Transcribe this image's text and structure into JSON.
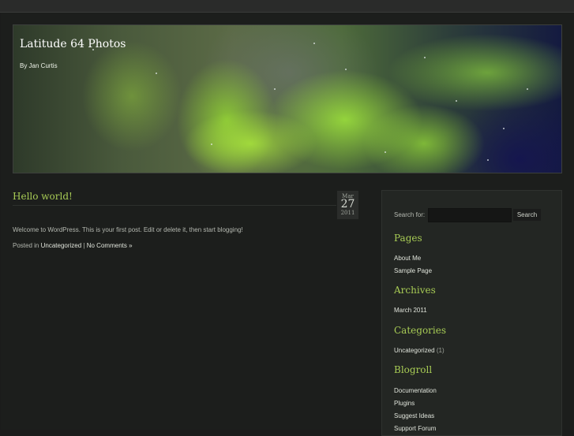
{
  "site": {
    "title": "Latitude 64 Photos",
    "description": "By Jan Curtis"
  },
  "post": {
    "title": "Hello world!",
    "date": {
      "month": "Mar",
      "day": "27",
      "year": "2011"
    },
    "body": "Welcome to WordPress. This is your first post. Edit or delete it, then start blogging!",
    "posted_in": "Posted in",
    "category": "Uncategorized",
    "separator": "|",
    "comments": "No Comments »"
  },
  "sidebar": {
    "search": {
      "label": "Search for:",
      "value": "",
      "button": "Search"
    },
    "pages": {
      "title": "Pages",
      "items": [
        "About Me",
        "Sample Page"
      ]
    },
    "archives": {
      "title": "Archives",
      "items": [
        "March 2011"
      ]
    },
    "categories": {
      "title": "Categories",
      "items": [
        {
          "label": "Uncategorized",
          "count": "(1)"
        }
      ]
    },
    "blogroll": {
      "title": "Blogroll",
      "items": [
        "Documentation",
        "Plugins",
        "Suggest Ideas",
        "Support Forum"
      ]
    }
  },
  "colors": {
    "accent": "#a8cc55",
    "background": "#1b1c1b",
    "sidebar": "#232623"
  }
}
